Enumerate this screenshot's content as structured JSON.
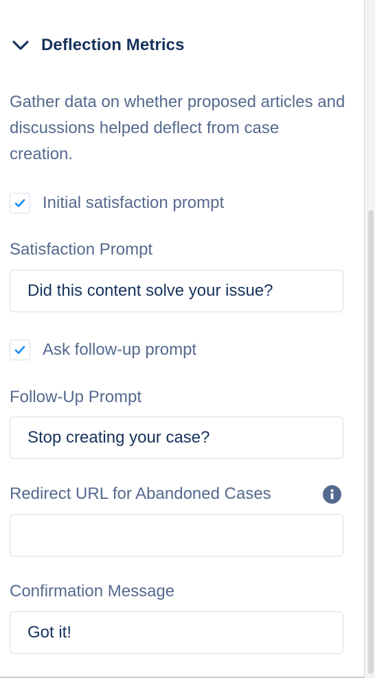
{
  "section": {
    "title": "Deflection Metrics",
    "toggle_icon": "chevron-down-icon",
    "description": "Gather data on whether proposed articles and discussions helped deflect from case creation."
  },
  "initial_satisfaction": {
    "label": "Initial satisfaction prompt",
    "checked": true
  },
  "satisfaction_prompt": {
    "label": "Satisfaction Prompt",
    "value": "Did this content solve your issue?"
  },
  "follow_up": {
    "label": "Ask follow-up prompt",
    "checked": true
  },
  "follow_up_prompt": {
    "label": "Follow-Up Prompt",
    "value": "Stop creating your case?"
  },
  "redirect_url": {
    "label": "Redirect URL for Abandoned Cases",
    "value": "",
    "help_icon": "info-icon"
  },
  "confirmation_message": {
    "label": "Confirmation Message",
    "value": "Got it!"
  },
  "colors": {
    "heading": "#16325c",
    "label": "#54698d",
    "check": "#1589ee",
    "border": "#d8dde6"
  }
}
